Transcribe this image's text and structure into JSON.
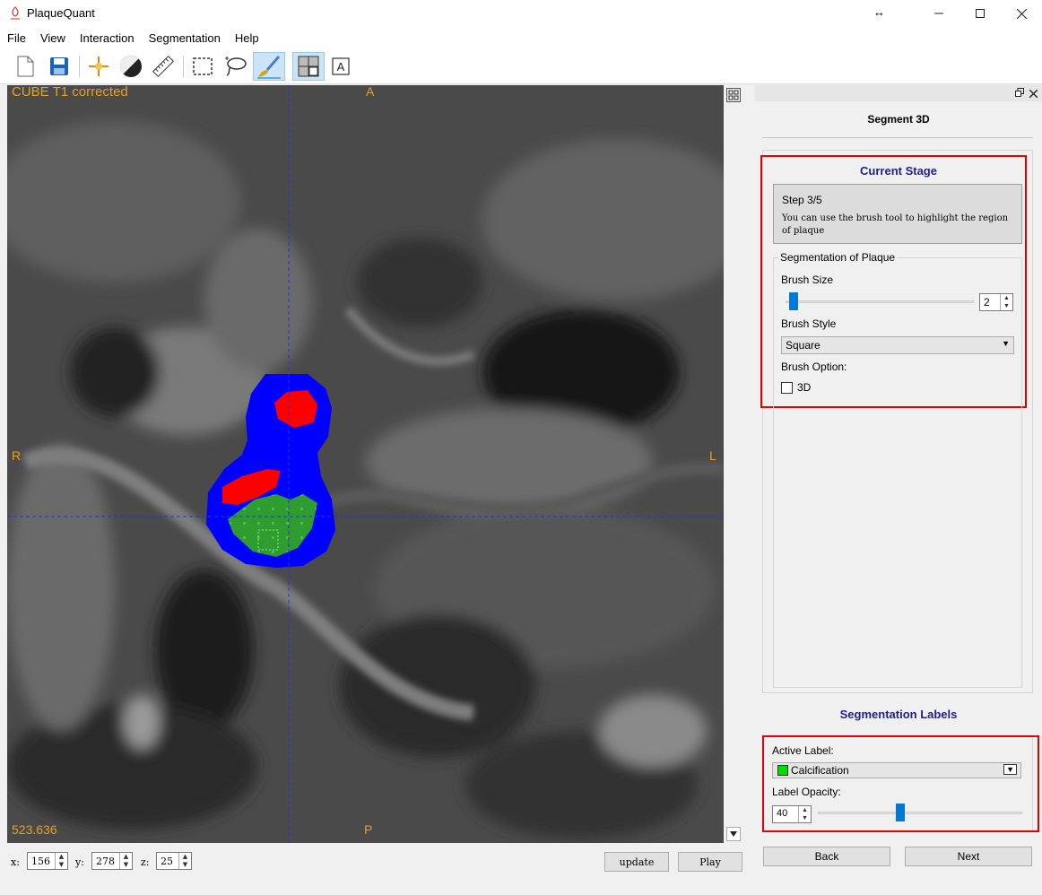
{
  "window": {
    "title": "PlaqueQuant"
  },
  "menu": [
    "File",
    "View",
    "Interaction",
    "Segmentation",
    "Help"
  ],
  "toolbar": {
    "icons": [
      "new-file-icon",
      "save-icon",
      "navigation-icon",
      "window-level-icon",
      "ruler-icon",
      "rectangle-select-icon",
      "lasso-icon",
      "brush-icon",
      "layout-icon",
      "text-icon"
    ],
    "active": "brush-icon"
  },
  "viewer": {
    "series_label": "CUBE T1 corrected",
    "orientation": {
      "top": "A",
      "bottom": "P",
      "left": "R",
      "right": "L"
    },
    "value_readout": "523.636",
    "colors": {
      "outer_wall": "#0000ff",
      "lipid": "#ff0000",
      "calcification": "#2e9c2e",
      "crosshair": "#2e2ee6",
      "overlay_text": "#e8a020"
    }
  },
  "coords": {
    "x_label": "x:",
    "x": "156",
    "y_label": "y:",
    "y": "278",
    "z_label": "z:",
    "z": "25",
    "update_label": "update",
    "play_label": "Play"
  },
  "panel": {
    "title": "Segment 3D",
    "current_stage": {
      "heading": "Current Stage",
      "step": "Step 3/5",
      "description": "You can use the brush tool to highlight the region of plaque"
    },
    "plaque": {
      "group_title": "Segmentation of Plaque",
      "brush_size_label": "Brush Size",
      "brush_size_value": "2",
      "brush_size_fraction": 0.02,
      "brush_style_label": "Brush Style",
      "brush_style_value": "Square",
      "brush_option_label": "Brush Option:",
      "option_3d_label": "3D",
      "option_3d_checked": false
    },
    "labels": {
      "heading": "Segmentation Labels",
      "active_label_label": "Active Label:",
      "active_label_value": "Calcification",
      "active_label_color": "#00e000",
      "opacity_label": "Label Opacity:",
      "opacity_value": "40",
      "opacity_fraction": 0.4
    },
    "back_label": "Back",
    "next_label": "Next"
  }
}
